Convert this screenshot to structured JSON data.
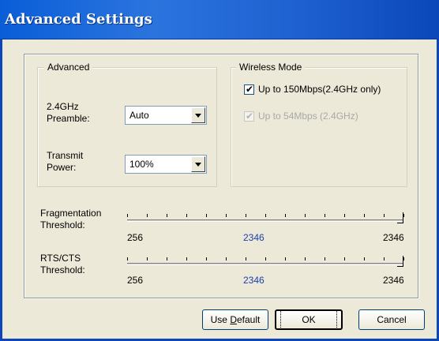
{
  "window": {
    "title": "Advanced Settings",
    "colors": {
      "title_bar": "#0A5ED8",
      "dialog_bg": "#ECE9D8",
      "value_blue": "#1A3FB0"
    }
  },
  "advanced_group": {
    "legend": "Advanced",
    "preamble": {
      "label": "2.4GHz\nPreamble:",
      "selected": "Auto"
    },
    "transmit_power": {
      "label": "Transmit\nPower:",
      "selected": "100%"
    }
  },
  "wireless_mode_group": {
    "legend": "Wireless Mode",
    "options": [
      {
        "label": "Up to 150Mbps(2.4GHz only)",
        "checked": true,
        "enabled": true
      },
      {
        "label": "Up to 54Mbps (2.4GHz)",
        "checked": true,
        "enabled": false
      }
    ]
  },
  "fragmentation": {
    "label": "Fragmentation\nThreshold:",
    "min": "256",
    "value": "2346",
    "max": "2346"
  },
  "rts_cts": {
    "label": "RTS/CTS\nThreshold:",
    "min": "256",
    "value": "2346",
    "max": "2346"
  },
  "buttons": {
    "use_default_prefix": "Use ",
    "use_default_accel": "D",
    "use_default_suffix": "efault",
    "ok": "OK",
    "cancel": "Cancel"
  }
}
